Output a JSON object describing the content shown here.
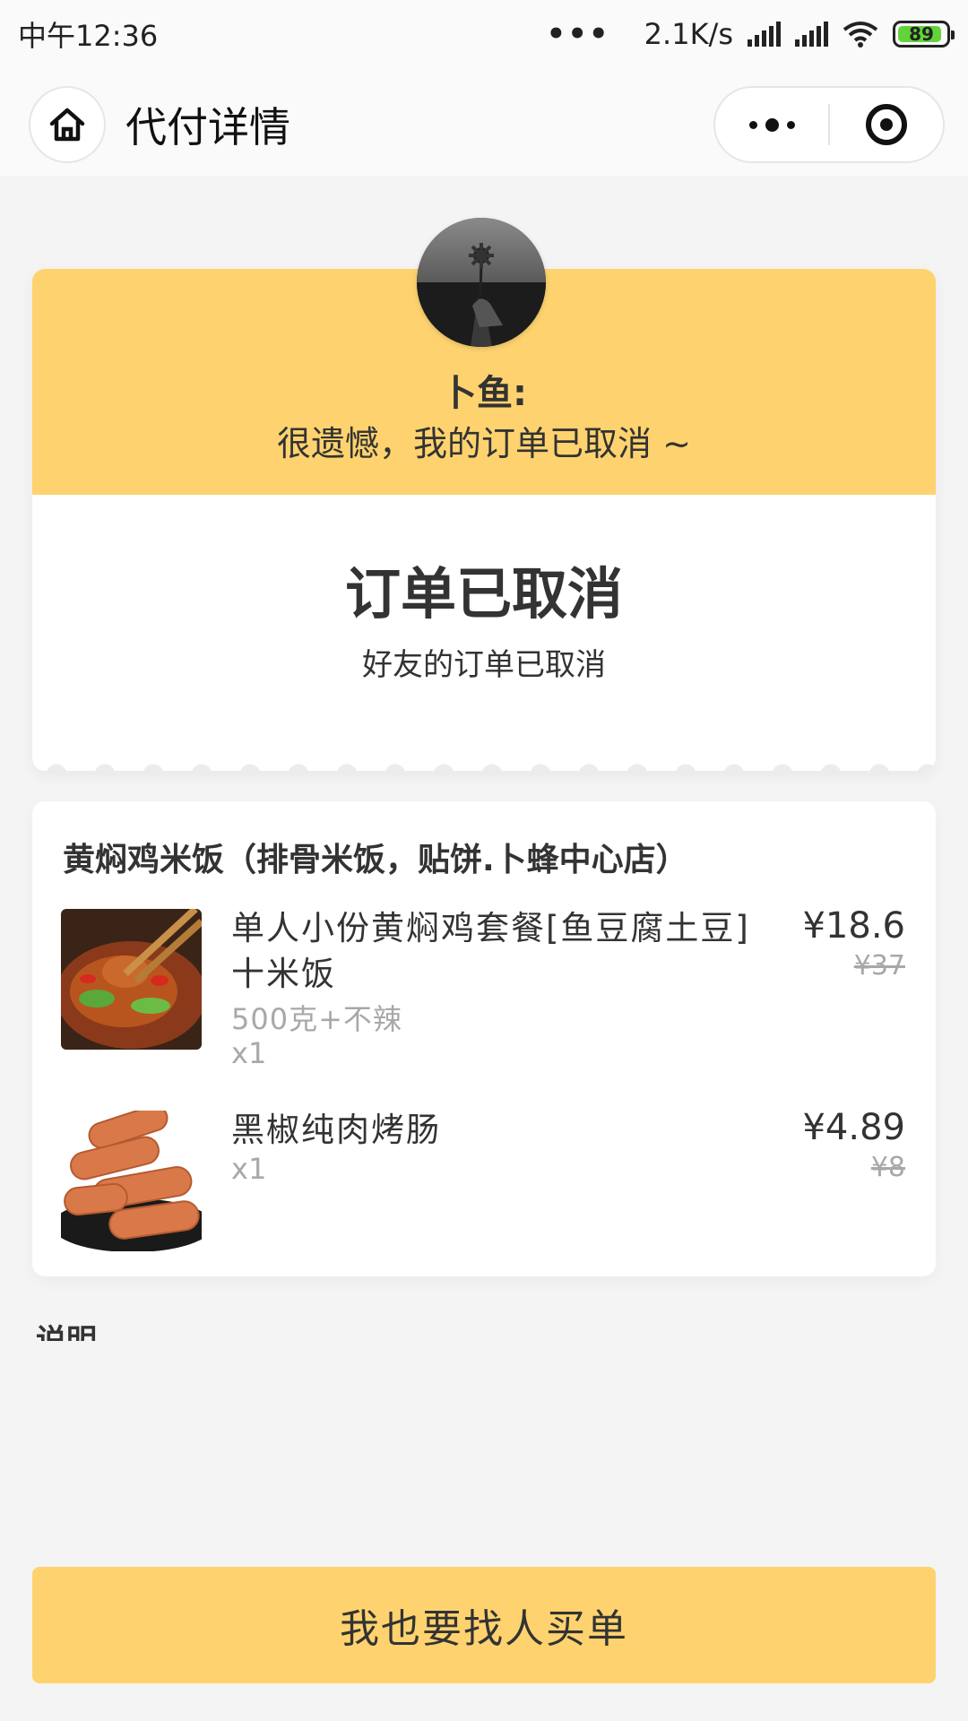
{
  "status_bar": {
    "time": "中午12:36",
    "network_speed": "2.1K/s",
    "battery_level": "89",
    "battery_color": "#63d33a"
  },
  "nav": {
    "title": "代付详情",
    "home_icon": "home-icon",
    "more_icon": "more-dots-icon",
    "close_icon": "target-icon"
  },
  "message": {
    "friend_name": "卜鱼:",
    "text": "很遗憾，我的订单已取消 ~",
    "status_title": "订单已取消",
    "status_subtitle": "好友的订单已取消"
  },
  "order": {
    "store_name": "黄焖鸡米饭（排骨米饭，贴饼.卜蜂中心店）",
    "items": [
      {
        "name": "单人小份黄焖鸡套餐[鱼豆腐土豆]十米饭",
        "spec": "500克+不辣",
        "qty": "x1",
        "price": "¥18.6",
        "original_price": "¥37"
      },
      {
        "name": "黑椒纯肉烤肠",
        "spec": "",
        "qty": "x1",
        "price": "¥4.89",
        "original_price": "¥8"
      }
    ]
  },
  "section": {
    "label": "说明"
  },
  "cta": {
    "label": "我也要找人买单"
  },
  "colors": {
    "accent": "#fed36f",
    "background": "#f4f4f4"
  }
}
